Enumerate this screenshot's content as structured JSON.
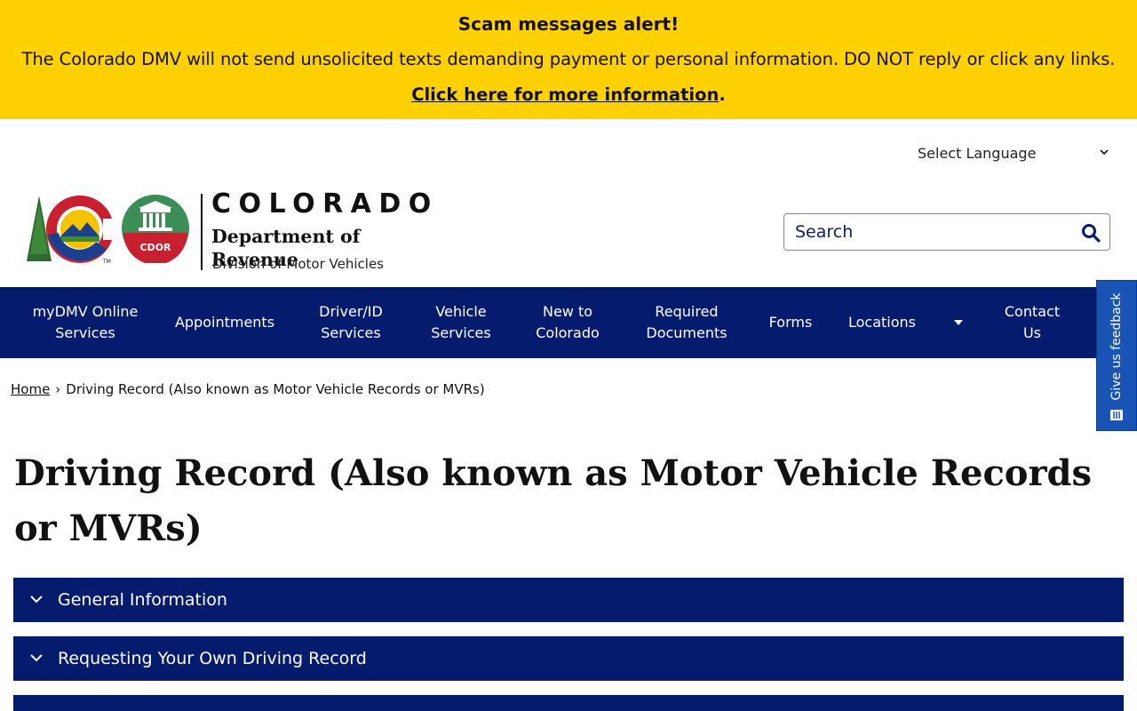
{
  "alert": {
    "title": "Scam messages alert!",
    "body": "The Colorado DMV will not send unsolicited texts demanding payment or personal information. DO NOT reply or click any links.",
    "link_label": "Click here for more information",
    "link_suffix": "."
  },
  "language": {
    "label": "Select Language"
  },
  "logo": {
    "state": "COLORADO",
    "department": "Department of Revenue",
    "division": "Division of Motor Vehicles",
    "seal_text": "CDOR",
    "tm": "TM"
  },
  "search": {
    "placeholder": "Search"
  },
  "nav": {
    "items": [
      {
        "label_line1": "myDMV Online",
        "label_line2": "Services"
      },
      {
        "label_line1": "Appointments",
        "label_line2": ""
      },
      {
        "label_line1": "Driver/ID",
        "label_line2": "Services"
      },
      {
        "label_line1": "Vehicle",
        "label_line2": "Services"
      },
      {
        "label_line1": "New to",
        "label_line2": "Colorado"
      },
      {
        "label_line1": "Required",
        "label_line2": "Documents"
      },
      {
        "label_line1": "Forms",
        "label_line2": ""
      },
      {
        "label_line1": "Locations",
        "label_line2": ""
      },
      {
        "label_line1": "Contact",
        "label_line2": "Us"
      }
    ],
    "bg_color": "#041b6e"
  },
  "feedback": {
    "label": "Give us feedback"
  },
  "breadcrumb": {
    "home": "Home",
    "separator": "›",
    "current": "Driving Record (Also known as Motor Vehicle Records or MVRs)"
  },
  "page": {
    "title": "Driving Record (Also known as Motor Vehicle Records or MVRs)"
  },
  "accordions": [
    {
      "label": "General Information"
    },
    {
      "label": "Requesting Your Own Driving Record"
    },
    {
      "label": ""
    }
  ],
  "colors": {
    "alert_bg": "#ffd100",
    "nav_bg": "#041b6e",
    "feedback_bg": "#1953b4"
  }
}
